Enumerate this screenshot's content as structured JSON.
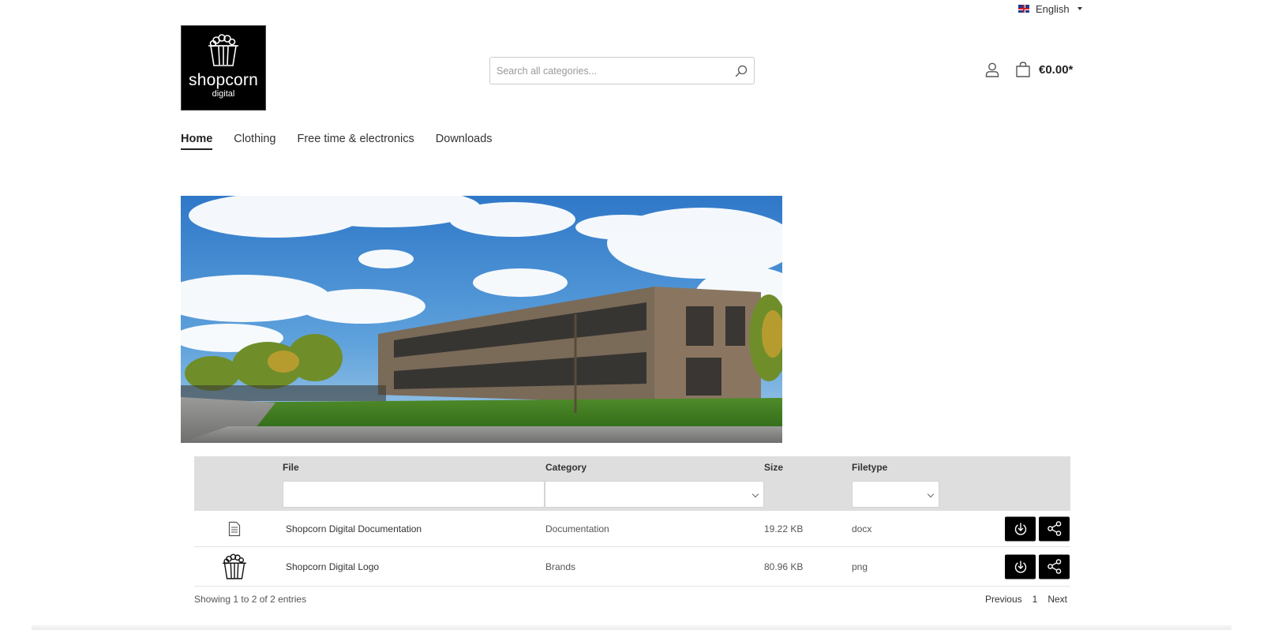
{
  "language": {
    "label": "English",
    "flag_icon": "uk-flag-icon"
  },
  "logo": {
    "brand": "shopcorn",
    "tagline": "digital",
    "icon": "popcorn-icon"
  },
  "search": {
    "placeholder": "Search all categories...",
    "value": ""
  },
  "header": {
    "account_icon": "user-icon",
    "cart_icon": "shopping-bag-icon",
    "cart_total": "€0.00*"
  },
  "nav": {
    "items": [
      {
        "label": "Home",
        "active": true
      },
      {
        "label": "Clothing",
        "active": false
      },
      {
        "label": "Free time & electronics",
        "active": false
      },
      {
        "label": "Downloads",
        "active": false
      }
    ]
  },
  "hero": {
    "alt": "Office building with wooden facade under blue sky"
  },
  "downloads": {
    "columns": {
      "file": "File",
      "category": "Category",
      "size": "Size",
      "filetype": "Filetype"
    },
    "filters": {
      "file": "",
      "category": "",
      "filetype": ""
    },
    "rows": [
      {
        "icon": "document-icon",
        "file": "Shopcorn Digital Documentation",
        "category": "Documentation",
        "size": "19.22 KB",
        "filetype": "docx"
      },
      {
        "icon": "popcorn-logo-icon",
        "file": "Shopcorn Digital Logo",
        "category": "Brands",
        "size": "80.96 KB",
        "filetype": "png"
      }
    ],
    "summary": "Showing 1 to 2 of 2 entries",
    "pagination": {
      "previous": "Previous",
      "current": "1",
      "next": "Next"
    }
  },
  "colors": {
    "button_bg": "#000000",
    "header_bg": "#dedede",
    "accent": "#222222"
  }
}
